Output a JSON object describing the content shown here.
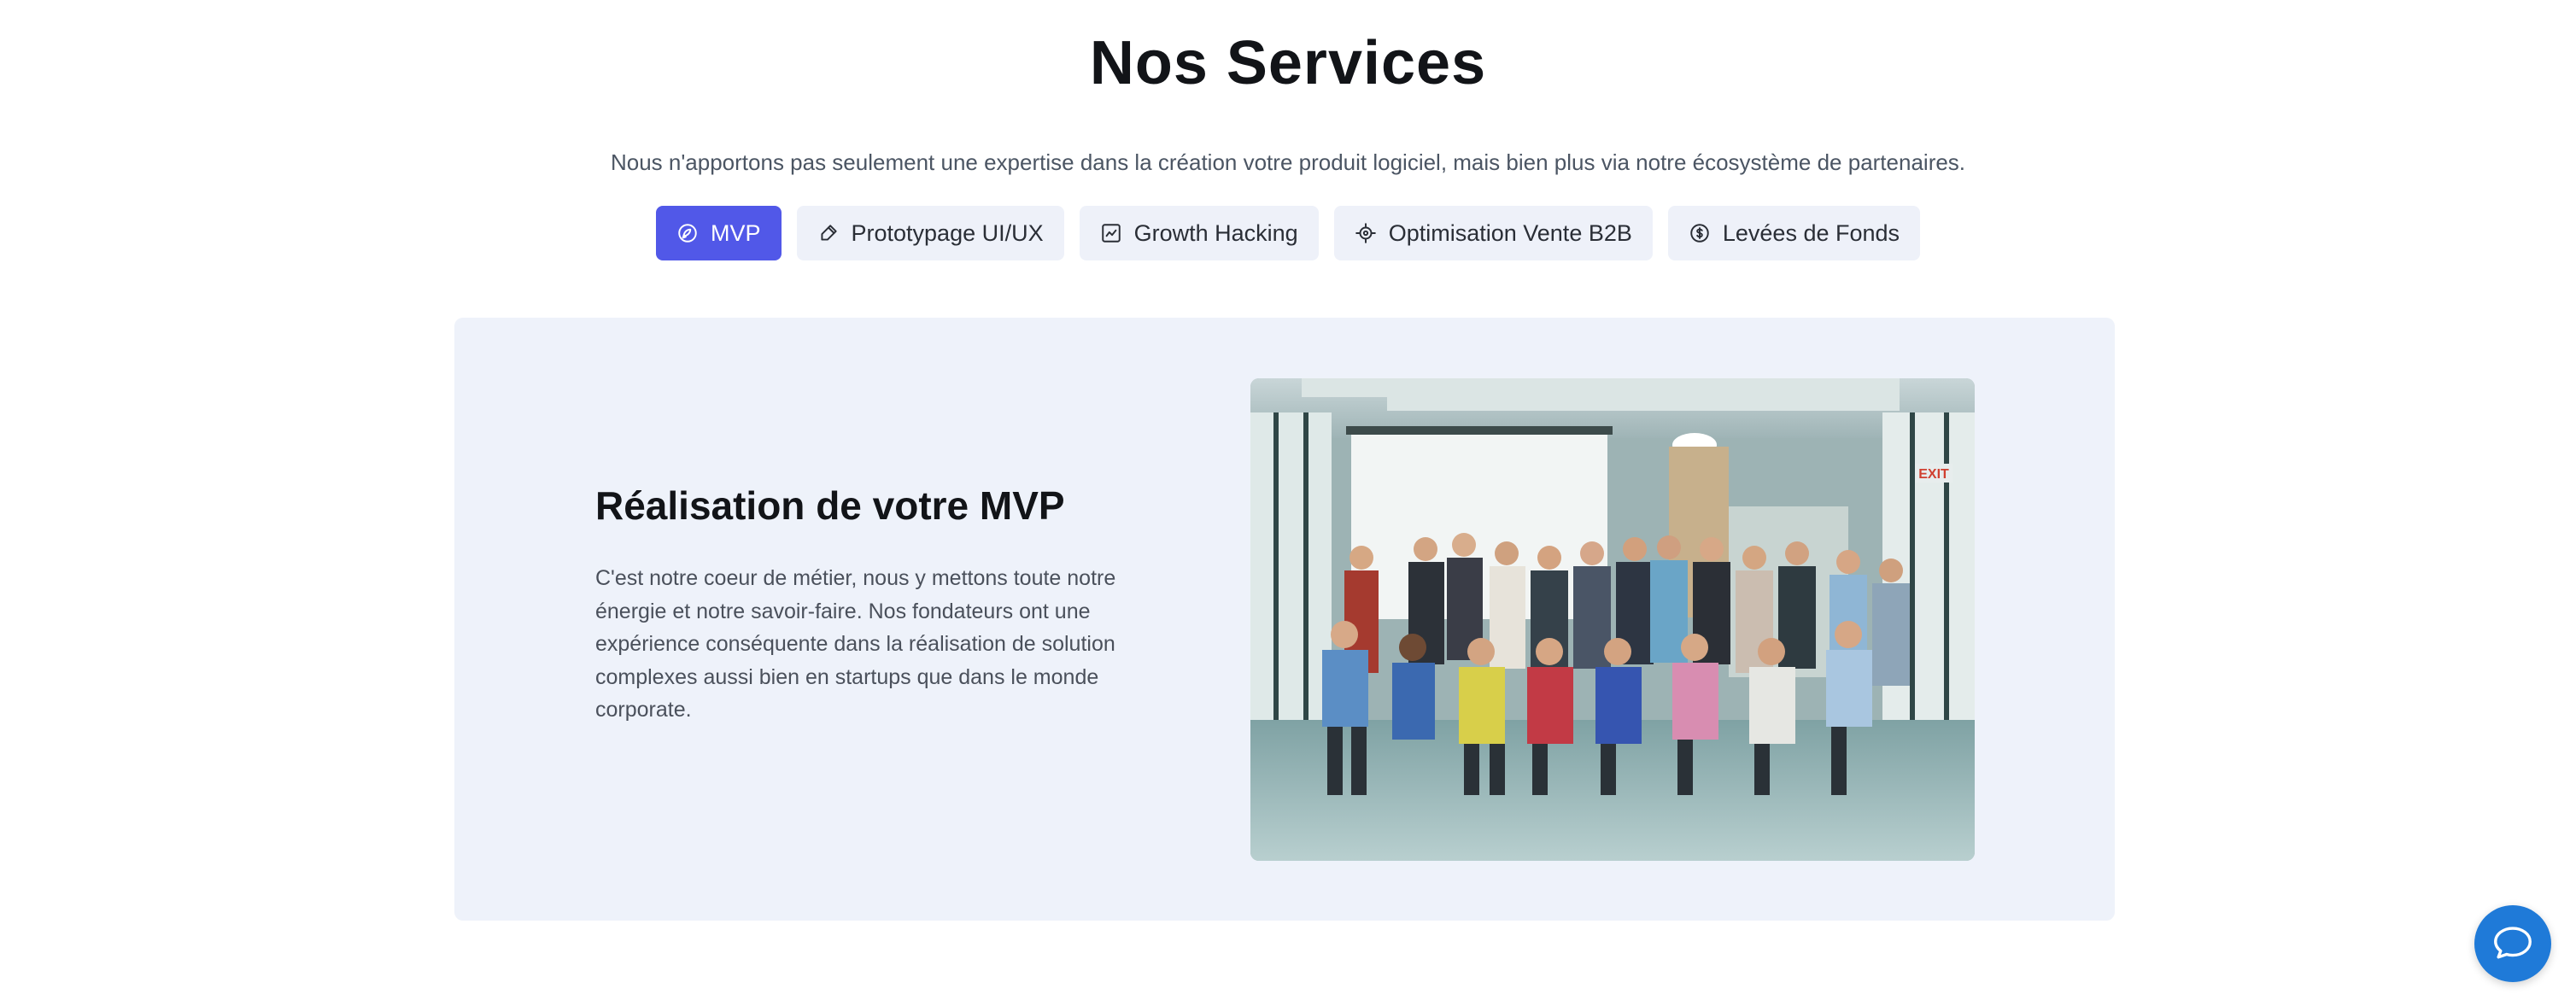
{
  "header": {
    "title": "Nos Services",
    "subtitle": "Nous n'apportons pas seulement une expertise dans la création votre produit logiciel, mais bien plus via notre écosystème de partenaires."
  },
  "tabs": [
    {
      "label": "MVP",
      "icon": "rocket-icon",
      "active": true
    },
    {
      "label": "Prototypage UI/UX",
      "icon": "pen-icon",
      "active": false
    },
    {
      "label": "Growth Hacking",
      "icon": "chart-icon",
      "active": false
    },
    {
      "label": "Optimisation Vente B2B",
      "icon": "target-icon",
      "active": false
    },
    {
      "label": "Levées de Fonds",
      "icon": "dollar-icon",
      "active": false
    }
  ],
  "panel": {
    "heading": "Réalisation de votre MVP",
    "text": "C'est notre coeur de métier, nous y mettons toute notre énergie et notre savoir-faire. Nos fondateurs ont une expérience conséquente dans la réalisation de solution complexes aussi bien en startups que dans le monde corporate.",
    "photo_exit_sign": "EXIT"
  },
  "colors": {
    "accent": "#5158e8",
    "tab_bg": "#eef1f9",
    "panel_bg": "#eef2fa",
    "chat": "#1f7ad8"
  },
  "chat": {
    "icon": "chat-bubble-icon"
  }
}
